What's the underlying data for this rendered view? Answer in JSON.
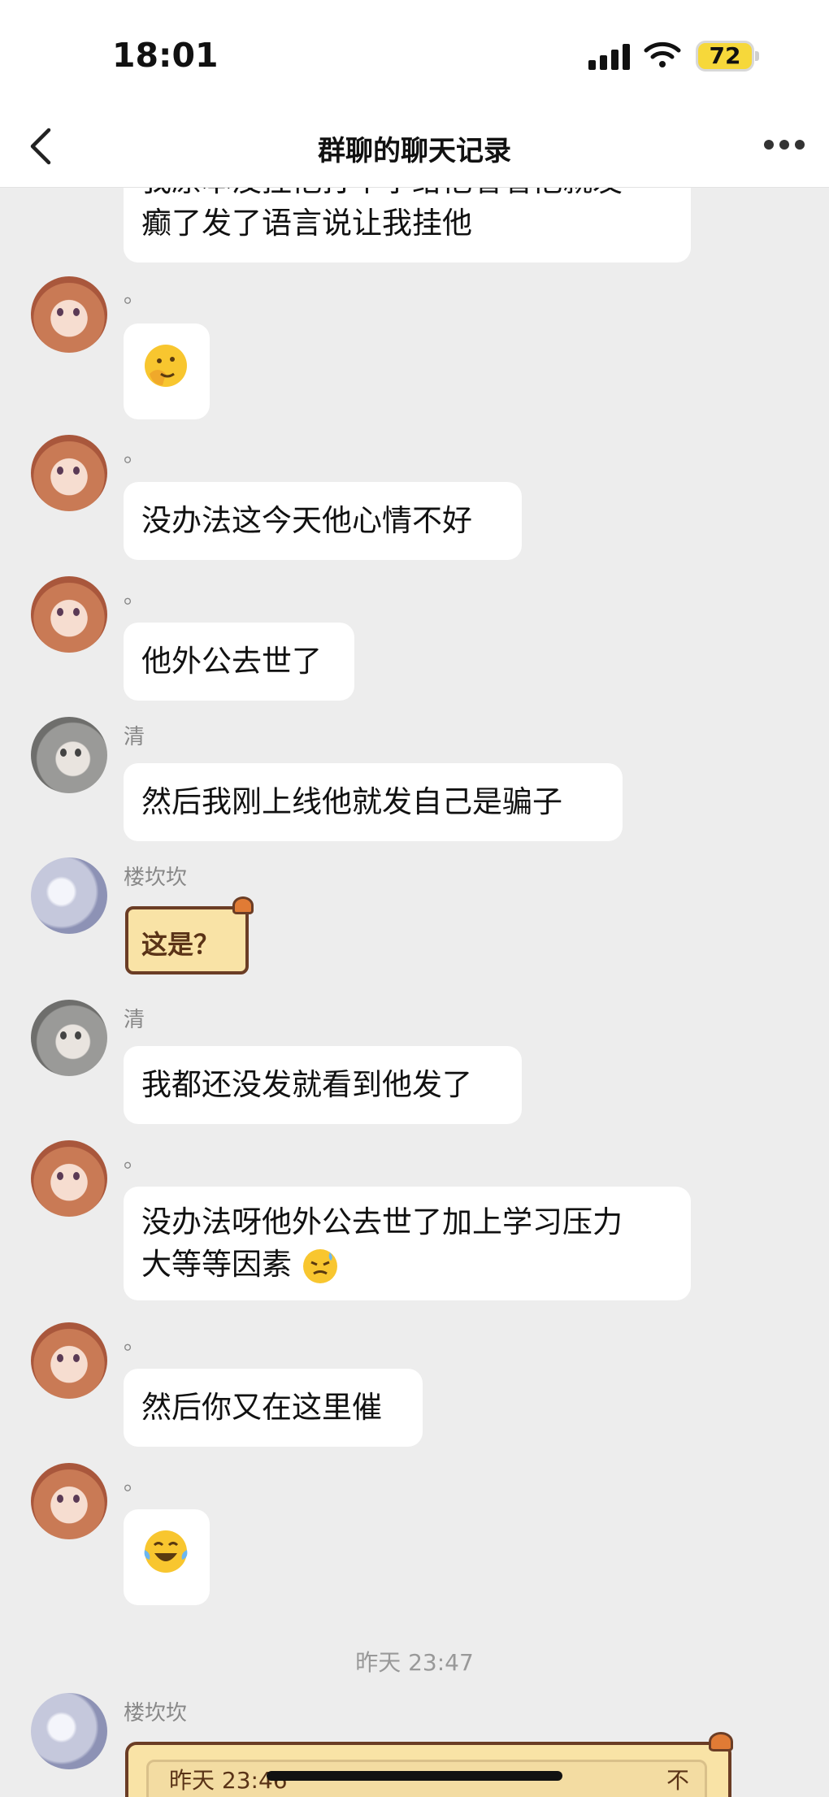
{
  "status": {
    "time": "18:01",
    "battery": "72"
  },
  "nav": {
    "title": "群聊的聊天记录"
  },
  "messages": [
    {
      "partial_text": "我原本没挂他打个字给他看看他就发癫了发了语言说让我挂他",
      "line1": "我原本没挂他打个字给他看看他就发",
      "line2": "癫了发了语言说让我挂他"
    },
    {
      "sender": "。",
      "emoji": "salute-face"
    },
    {
      "sender": "。",
      "text": "没办法这今天他心情不好"
    },
    {
      "sender": "。",
      "text": "他外公去世了"
    },
    {
      "sender": "清",
      "text": "然后我刚上线他就发自己是骗子"
    },
    {
      "sender": "楼坎坎",
      "sticker_text": "这是？"
    },
    {
      "sender": "清",
      "text": "我都还没发就看到他发了"
    },
    {
      "sender": "。",
      "line1": "没办法呀他外公去世了加上学习压力",
      "line2": "大等等因素"
    },
    {
      "sender": "。",
      "text": "然后你又在这里催"
    },
    {
      "sender": "。",
      "emoji": "tears-of-joy"
    },
    {
      "timestamp": "昨天 23:47"
    },
    {
      "sender": "楼坎坎",
      "sticker_text": "昨天 23:46",
      "sticker_right": "不"
    }
  ]
}
